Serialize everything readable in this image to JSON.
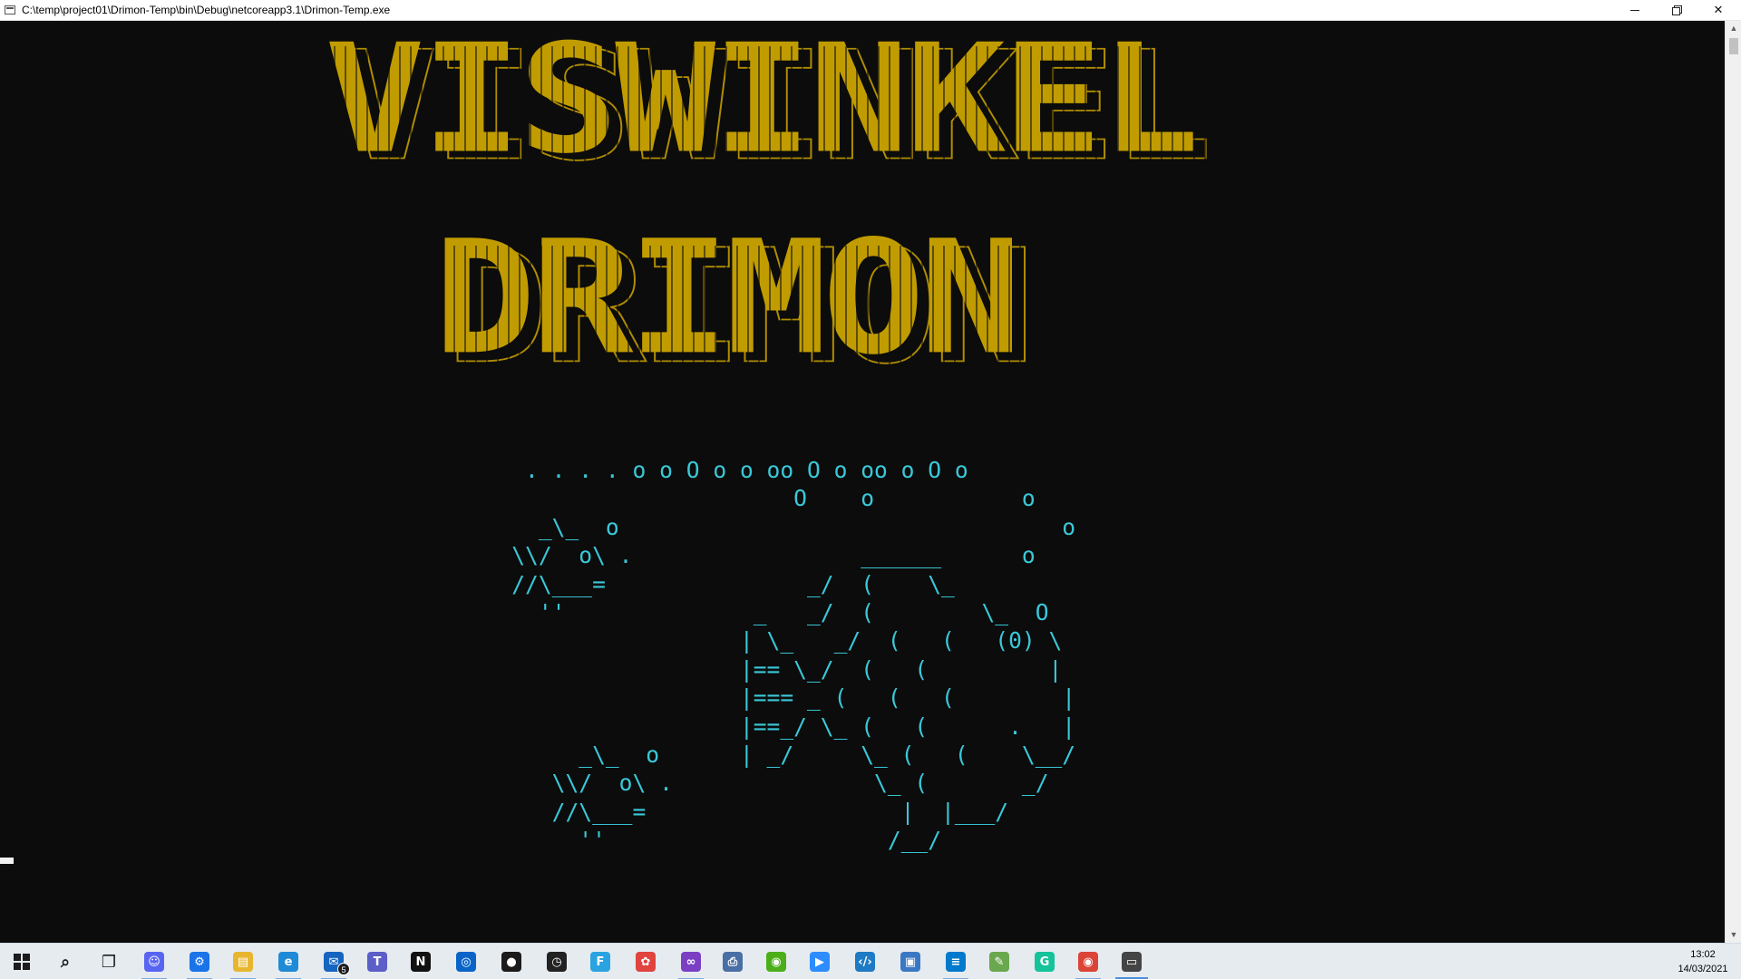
{
  "window": {
    "title": "C:\\temp\\project01\\Drimon-Temp\\bin\\Debug\\netcoreapp3.1\\Drimon-Temp.exe",
    "min_label": "–",
    "max_label": "❐",
    "close_label": "✕"
  },
  "console": {
    "banner_line1": "VISWINKEL",
    "banner_line2": "DRIMON",
    "ascii_art": "     . . . . o o O o o oo O o oo o O o\n                         O    o           o\n      _\\_  o                                 o\n    \\\\/  o\\ .                 ______      o\n    //\\___=               _/  (    \\_\n      ''              _   _/  (        \\_  O\n                     | \\_   _/  (   (   (0) \\\n                     |== \\_/  (   (         |\n                     |=== _ (   (   (        |\n                     |==_/ \\_ (   (      .   |\n         _\\_  o      | _/     \\_ (   (    \\__/\n       \\\\/  o\\ .               \\_ (       _/\n       //\\___=                   |  |___/\n         ''                     /__/",
    "ascii_color": "#3ac8d8",
    "banner_color": "#c19c00"
  },
  "taskbar": {
    "items": [
      {
        "name": "start-button",
        "icon": "windows-icon",
        "glyph": ""
      },
      {
        "name": "search-button",
        "icon": "search-icon",
        "glyph": "⌕"
      },
      {
        "name": "task-view-button",
        "icon": "task-view-icon",
        "glyph": "❐"
      },
      {
        "name": "discord-app",
        "icon": "discord-icon",
        "glyph": "☺",
        "color": "#5865f2"
      },
      {
        "name": "settings-app",
        "icon": "gear-icon",
        "glyph": "⚙",
        "color": "#1a73e8"
      },
      {
        "name": "file-explorer-app",
        "icon": "folder-icon",
        "glyph": "▤",
        "color": "#e8b62e"
      },
      {
        "name": "edge-app",
        "icon": "edge-icon",
        "glyph": "e",
        "color": "#1f8ad6"
      },
      {
        "name": "mail-app",
        "icon": "mail-icon",
        "glyph": "✉",
        "color": "#1565c0",
        "badge": "5"
      },
      {
        "name": "teams-app",
        "icon": "teams-icon",
        "glyph": "T",
        "color": "#5b5fc7"
      },
      {
        "name": "netflix-app",
        "icon": "netflix-icon",
        "glyph": "N",
        "color": "#111111"
      },
      {
        "name": "camera-app",
        "icon": "camera-icon",
        "glyph": "◎",
        "color": "#0a64c8"
      },
      {
        "name": "github-app",
        "icon": "github-icon",
        "glyph": "●",
        "color": "#1b1b1b"
      },
      {
        "name": "timer-app",
        "icon": "timer-icon",
        "glyph": "◷",
        "color": "#222222"
      },
      {
        "name": "fiddler-app",
        "icon": "fiddler-icon",
        "glyph": "F",
        "color": "#2aa3e0"
      },
      {
        "name": "paint-app",
        "icon": "paint-icon",
        "glyph": "✿",
        "color": "#e0443e"
      },
      {
        "name": "visual-studio-app",
        "icon": "visual-studio-icon",
        "glyph": "∞",
        "color": "#7b3fc4"
      },
      {
        "name": "printer-app",
        "icon": "printer-icon",
        "glyph": "⎙",
        "color": "#4a6fa5"
      },
      {
        "name": "nvidia-app",
        "icon": "nvidia-icon",
        "glyph": "◉",
        "color": "#4caf1a"
      },
      {
        "name": "zoom-app",
        "icon": "zoom-icon",
        "glyph": "▶",
        "color": "#2d8cff"
      },
      {
        "name": "code-editor-app",
        "icon": "code-icon",
        "glyph": "‹/›",
        "color": "#1e7ac4"
      },
      {
        "name": "window-app",
        "icon": "window-icon",
        "glyph": "▣",
        "color": "#3b78c4"
      },
      {
        "name": "vscode-app",
        "icon": "vscode-icon",
        "glyph": "≡",
        "color": "#007acc"
      },
      {
        "name": "notepad-app",
        "icon": "notepad-icon",
        "glyph": "✎",
        "color": "#6aa84f"
      },
      {
        "name": "grammarly-app",
        "icon": "grammarly-icon",
        "glyph": "G",
        "color": "#15c39a"
      },
      {
        "name": "chrome-app",
        "icon": "chrome-icon",
        "glyph": "◉",
        "color": "#db4437"
      },
      {
        "name": "console-app",
        "icon": "console-icon",
        "glyph": "▭",
        "color": "#444444"
      }
    ],
    "clock_time": "13:02",
    "clock_date": "14/03/2021"
  }
}
